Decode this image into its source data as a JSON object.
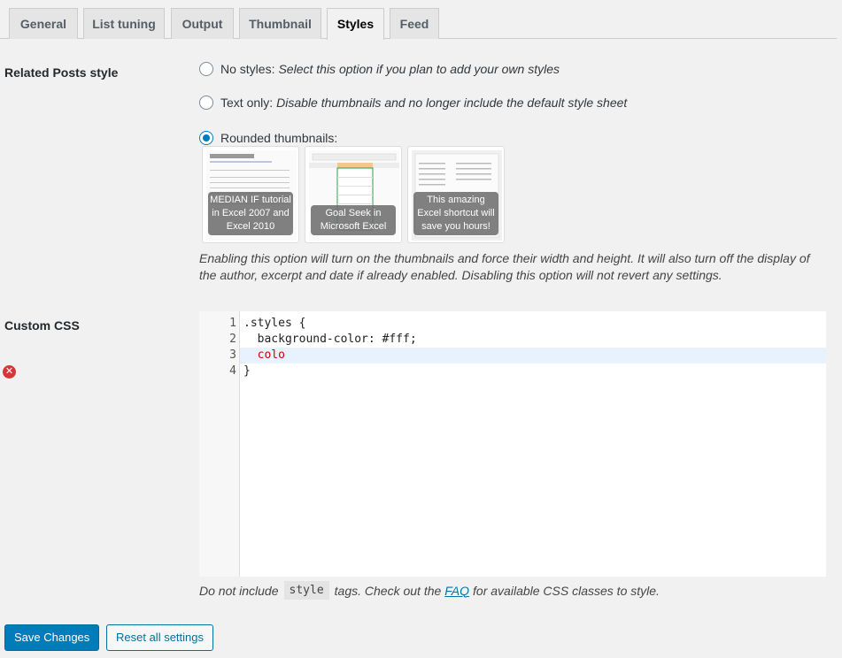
{
  "tabs": [
    "General",
    "List tuning",
    "Output",
    "Thumbnail",
    "Styles",
    "Feed"
  ],
  "active_tab": "Styles",
  "related_style": {
    "label": "Related Posts style",
    "options": [
      {
        "name": "No styles:",
        "desc": "Select this option if you plan to add your own styles"
      },
      {
        "name": "Text only:",
        "desc": "Disable thumbnails and no longer include the default style sheet"
      },
      {
        "name": "Rounded thumbnails:",
        "desc": ""
      }
    ],
    "selected": "Rounded thumbnails:",
    "thumbnails": [
      "MEDIAN IF tutorial in Excel 2007 and Excel 2010",
      "Goal Seek in Microsoft Excel",
      "This amazing Excel shortcut will save you hours!"
    ],
    "description": "Enabling this option will turn on the thumbnails and force their width and height. It will also turn off the display of the author, excerpt and date if already enabled. Disabling this option will not revert any settings."
  },
  "custom_css": {
    "label": "Custom CSS",
    "lines": [
      {
        "num": "1",
        "text": ".styles {"
      },
      {
        "num": "2",
        "text": "  background-color: #fff;"
      },
      {
        "num": "3",
        "text": "  colo"
      },
      {
        "num": "4",
        "text": "}"
      }
    ],
    "active_line": "3",
    "error_line": "4",
    "hint_before": "Do not include",
    "hint_code": "style",
    "hint_middle": "tags. Check out the",
    "hint_link": "FAQ",
    "hint_after": "for available CSS classes to style."
  },
  "buttons": {
    "save": "Save Changes",
    "reset": "Reset all settings"
  },
  "colors": {
    "primary": "#007cba",
    "error": "#d63638"
  }
}
